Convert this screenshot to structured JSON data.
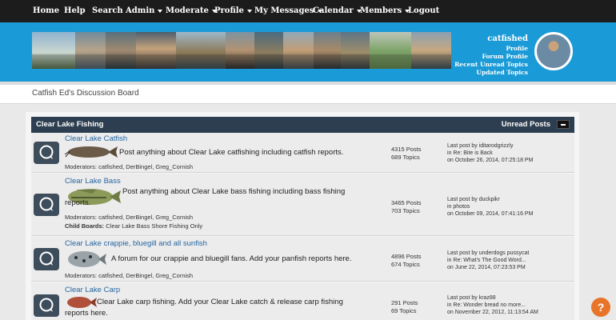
{
  "nav": [
    {
      "label": "Home",
      "dropdown": false
    },
    {
      "label": "Help",
      "dropdown": false
    },
    {
      "label": "Search",
      "dropdown": false
    },
    {
      "label": "Admin",
      "dropdown": true
    },
    {
      "label": "Moderate",
      "dropdown": true
    },
    {
      "label": "Profile",
      "dropdown": true
    },
    {
      "label": "My Messages",
      "dropdown": true
    },
    {
      "label": "Calendar",
      "dropdown": true
    },
    {
      "label": "Members",
      "dropdown": true
    },
    {
      "label": "Logout",
      "dropdown": false
    }
  ],
  "header": {
    "username": "catfished",
    "links": [
      "Profile",
      "Forum Profile",
      "Recent Unread Topics",
      "Updated Topics"
    ],
    "accent_color": "#1a9ad6"
  },
  "board_title": "Catfish Ed's Discussion Board",
  "category": {
    "title": "Clear Lake Fishing",
    "unread_label": "Unread Posts",
    "toggle_icon": "collapse-icon"
  },
  "boards": [
    {
      "title": "Clear Lake Catfish",
      "description": "Post anything about Clear Lake catfishing including catfish reports.",
      "moderators": "Moderators: catfished, DerBingel, Greg_Cornish",
      "child_boards_label": "",
      "child_boards": "",
      "posts": "4315 Posts",
      "topics": "689 Topics",
      "last_post": "Last post by iditarodgrizzly",
      "last_in": "in Re: Bite is Back",
      "last_on": "on October 26, 2014, 07:25:18 PM"
    },
    {
      "title": "Clear Lake Bass",
      "description": "Post anything about Clear Lake bass fishing including bass fishing reports.",
      "moderators": "Moderators: catfished, DerBingel, Greg_Cornish",
      "child_boards_label": "Child Boards:",
      "child_boards": "Clear Lake Bass Shore Fishing Only",
      "posts": "3465 Posts",
      "topics": "703 Topics",
      "last_post": "Last post by duckpikr",
      "last_in": "in photos",
      "last_on": "on October 09, 2014, 07:41:16 PM"
    },
    {
      "title": "Clear Lake crappie, bluegill and all sunfish",
      "description": "A forum for our crappie and bluegill fans. Add your panfish reports here.",
      "moderators": "Moderators: catfished, DerBingel, Greg_Cornish",
      "child_boards_label": "",
      "child_boards": "",
      "posts": "4896 Posts",
      "topics": "674 Topics",
      "last_post": "Last post by underdogs pussycat",
      "last_in": "in Re: What's The Good Word...",
      "last_on": "on June 22, 2014, 07:23:53 PM"
    },
    {
      "title": "Clear Lake Carp",
      "description": "Clear Lake carp fishing. Add your Clear Lake catch & release carp fishing reports here.",
      "moderators": "",
      "child_boards_label": "",
      "child_boards": "",
      "posts": "291 Posts",
      "topics": "69 Topics",
      "last_post": "Last post by kraz88",
      "last_in": "in Re: Wonder bread no more...",
      "last_on": "on November 22, 2012, 11:13:54 AM"
    }
  ],
  "help_button": "?"
}
